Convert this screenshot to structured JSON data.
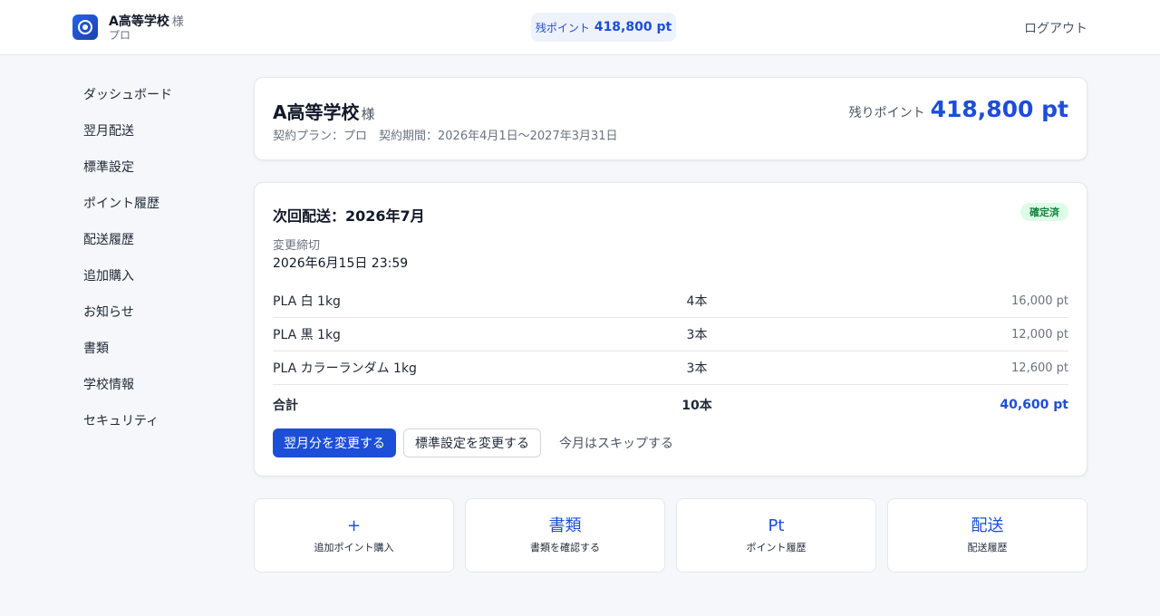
{
  "header": {
    "school_name": "A高等学校",
    "suffix": "様",
    "plan": "プロ",
    "points_label": "残ポイント",
    "points_value": "418,800 pt",
    "logout": "ログアウト"
  },
  "sidebar": {
    "items": [
      {
        "label": "ダッシュボード"
      },
      {
        "label": "翌月配送"
      },
      {
        "label": "標準設定"
      },
      {
        "label": "ポイント履歴"
      },
      {
        "label": "配送履歴"
      },
      {
        "label": "追加購入"
      },
      {
        "label": "お知らせ"
      },
      {
        "label": "書類"
      },
      {
        "label": "学校情報"
      },
      {
        "label": "セキュリティ"
      }
    ]
  },
  "summary": {
    "school_name": "A高等学校",
    "suffix": "様",
    "contract": "契約プラン：プロ　契約期間：2026年4月1日〜2027年3月31日",
    "remain_label": "残りポイント",
    "remain_value": "418,800 pt"
  },
  "delivery": {
    "title": "次回配送：2026年7月",
    "status": "確定済",
    "status_color": "#15803d",
    "deadline_label": "変更締切",
    "deadline_value": "2026年6月15日 23:59",
    "items": [
      {
        "name": "PLA 白 1kg",
        "qty": "4本",
        "points": "16,000 pt"
      },
      {
        "name": "PLA 黒 1kg",
        "qty": "3本",
        "points": "12,000 pt"
      },
      {
        "name": "PLA カラーランダム 1kg",
        "qty": "3本",
        "points": "12,600 pt"
      }
    ],
    "total": {
      "label": "合計",
      "qty": "10本",
      "points": "40,600 pt"
    },
    "actions": {
      "change_next": "翌月分を変更する",
      "change_default": "標準設定を変更する",
      "skip": "今月はスキップする"
    }
  },
  "quick_links": [
    {
      "head": "+",
      "sub": "追加ポイント購入"
    },
    {
      "head": "書類",
      "sub": "書類を確認する"
    },
    {
      "head": "Pt",
      "sub": "ポイント履歴"
    },
    {
      "head": "配送",
      "sub": "配送履歴"
    }
  ],
  "colors": {
    "accent": "#1d4ed8",
    "background": "#f5f7fa",
    "badge_bg": "#dcfce7"
  }
}
